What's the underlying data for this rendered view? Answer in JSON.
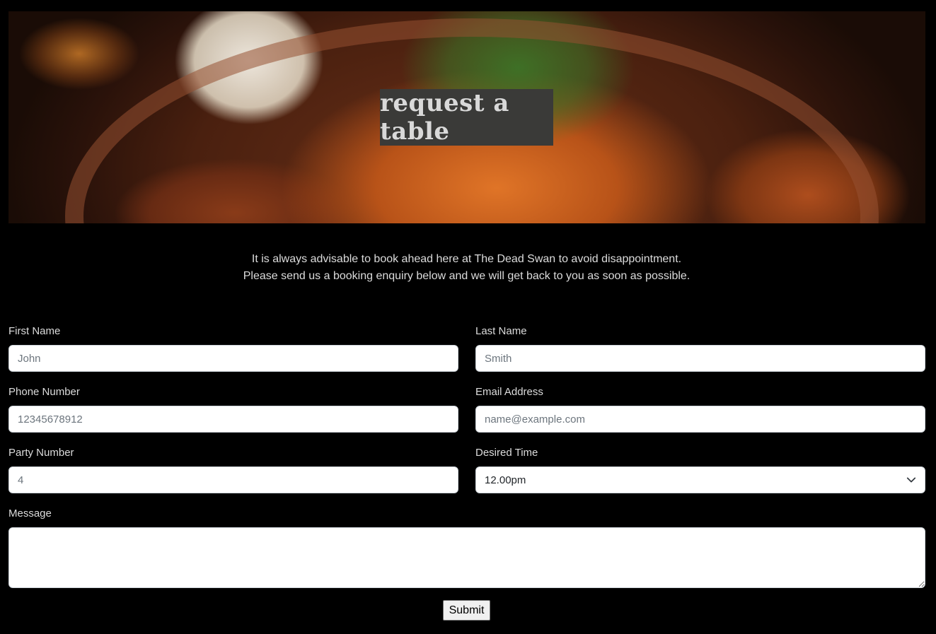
{
  "hero": {
    "title": "request a table"
  },
  "intro": {
    "line1": "It is always advisable to book ahead here at The Dead Swan to avoid disappointment.",
    "line2": "Please send us a booking enquiry below and we will get back to you as soon as possible."
  },
  "form": {
    "first_name": {
      "label": "First Name",
      "placeholder": "John"
    },
    "last_name": {
      "label": "Last Name",
      "placeholder": "Smith"
    },
    "phone": {
      "label": "Phone Number",
      "placeholder": "12345678912"
    },
    "email": {
      "label": "Email Address",
      "placeholder": "name@example.com"
    },
    "party": {
      "label": "Party Number",
      "placeholder": "4"
    },
    "time": {
      "label": "Desired Time",
      "selected": "12.00pm",
      "icon": "chevron-down-icon"
    },
    "message": {
      "label": "Message",
      "value": ""
    },
    "submit_label": "Submit"
  }
}
